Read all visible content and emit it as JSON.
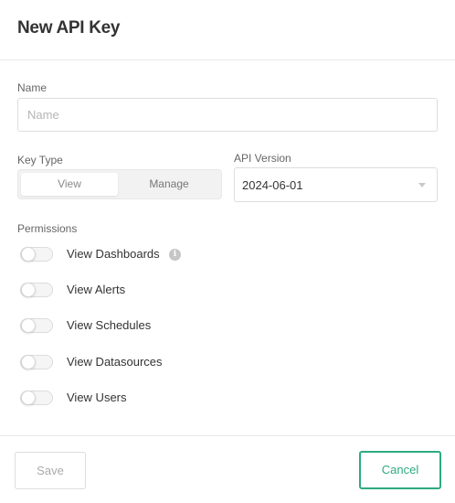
{
  "dialog": {
    "title": "New API Key"
  },
  "form": {
    "name_label": "Name",
    "name_placeholder": "Name",
    "name_value": "",
    "key_type_label": "Key Type",
    "key_type_options": [
      "View",
      "Manage"
    ],
    "key_type_selected": "View",
    "api_version_label": "API Version",
    "api_version_value": "2024-06-01",
    "permissions_label": "Permissions",
    "permissions": [
      {
        "label": "View Dashboards",
        "enabled": false,
        "info": true
      },
      {
        "label": "View Alerts",
        "enabled": false
      },
      {
        "label": "View Schedules",
        "enabled": false
      },
      {
        "label": "View Datasources",
        "enabled": false
      },
      {
        "label": "View Users",
        "enabled": false
      }
    ]
  },
  "footer": {
    "save_label": "Save",
    "cancel_label": "Cancel"
  },
  "colors": {
    "accent": "#2dab7f",
    "border": "#dddddd",
    "text": "#333333",
    "muted": "#666666"
  },
  "icons": {
    "info": "info-icon",
    "dropdown": "chevron-down-icon"
  }
}
